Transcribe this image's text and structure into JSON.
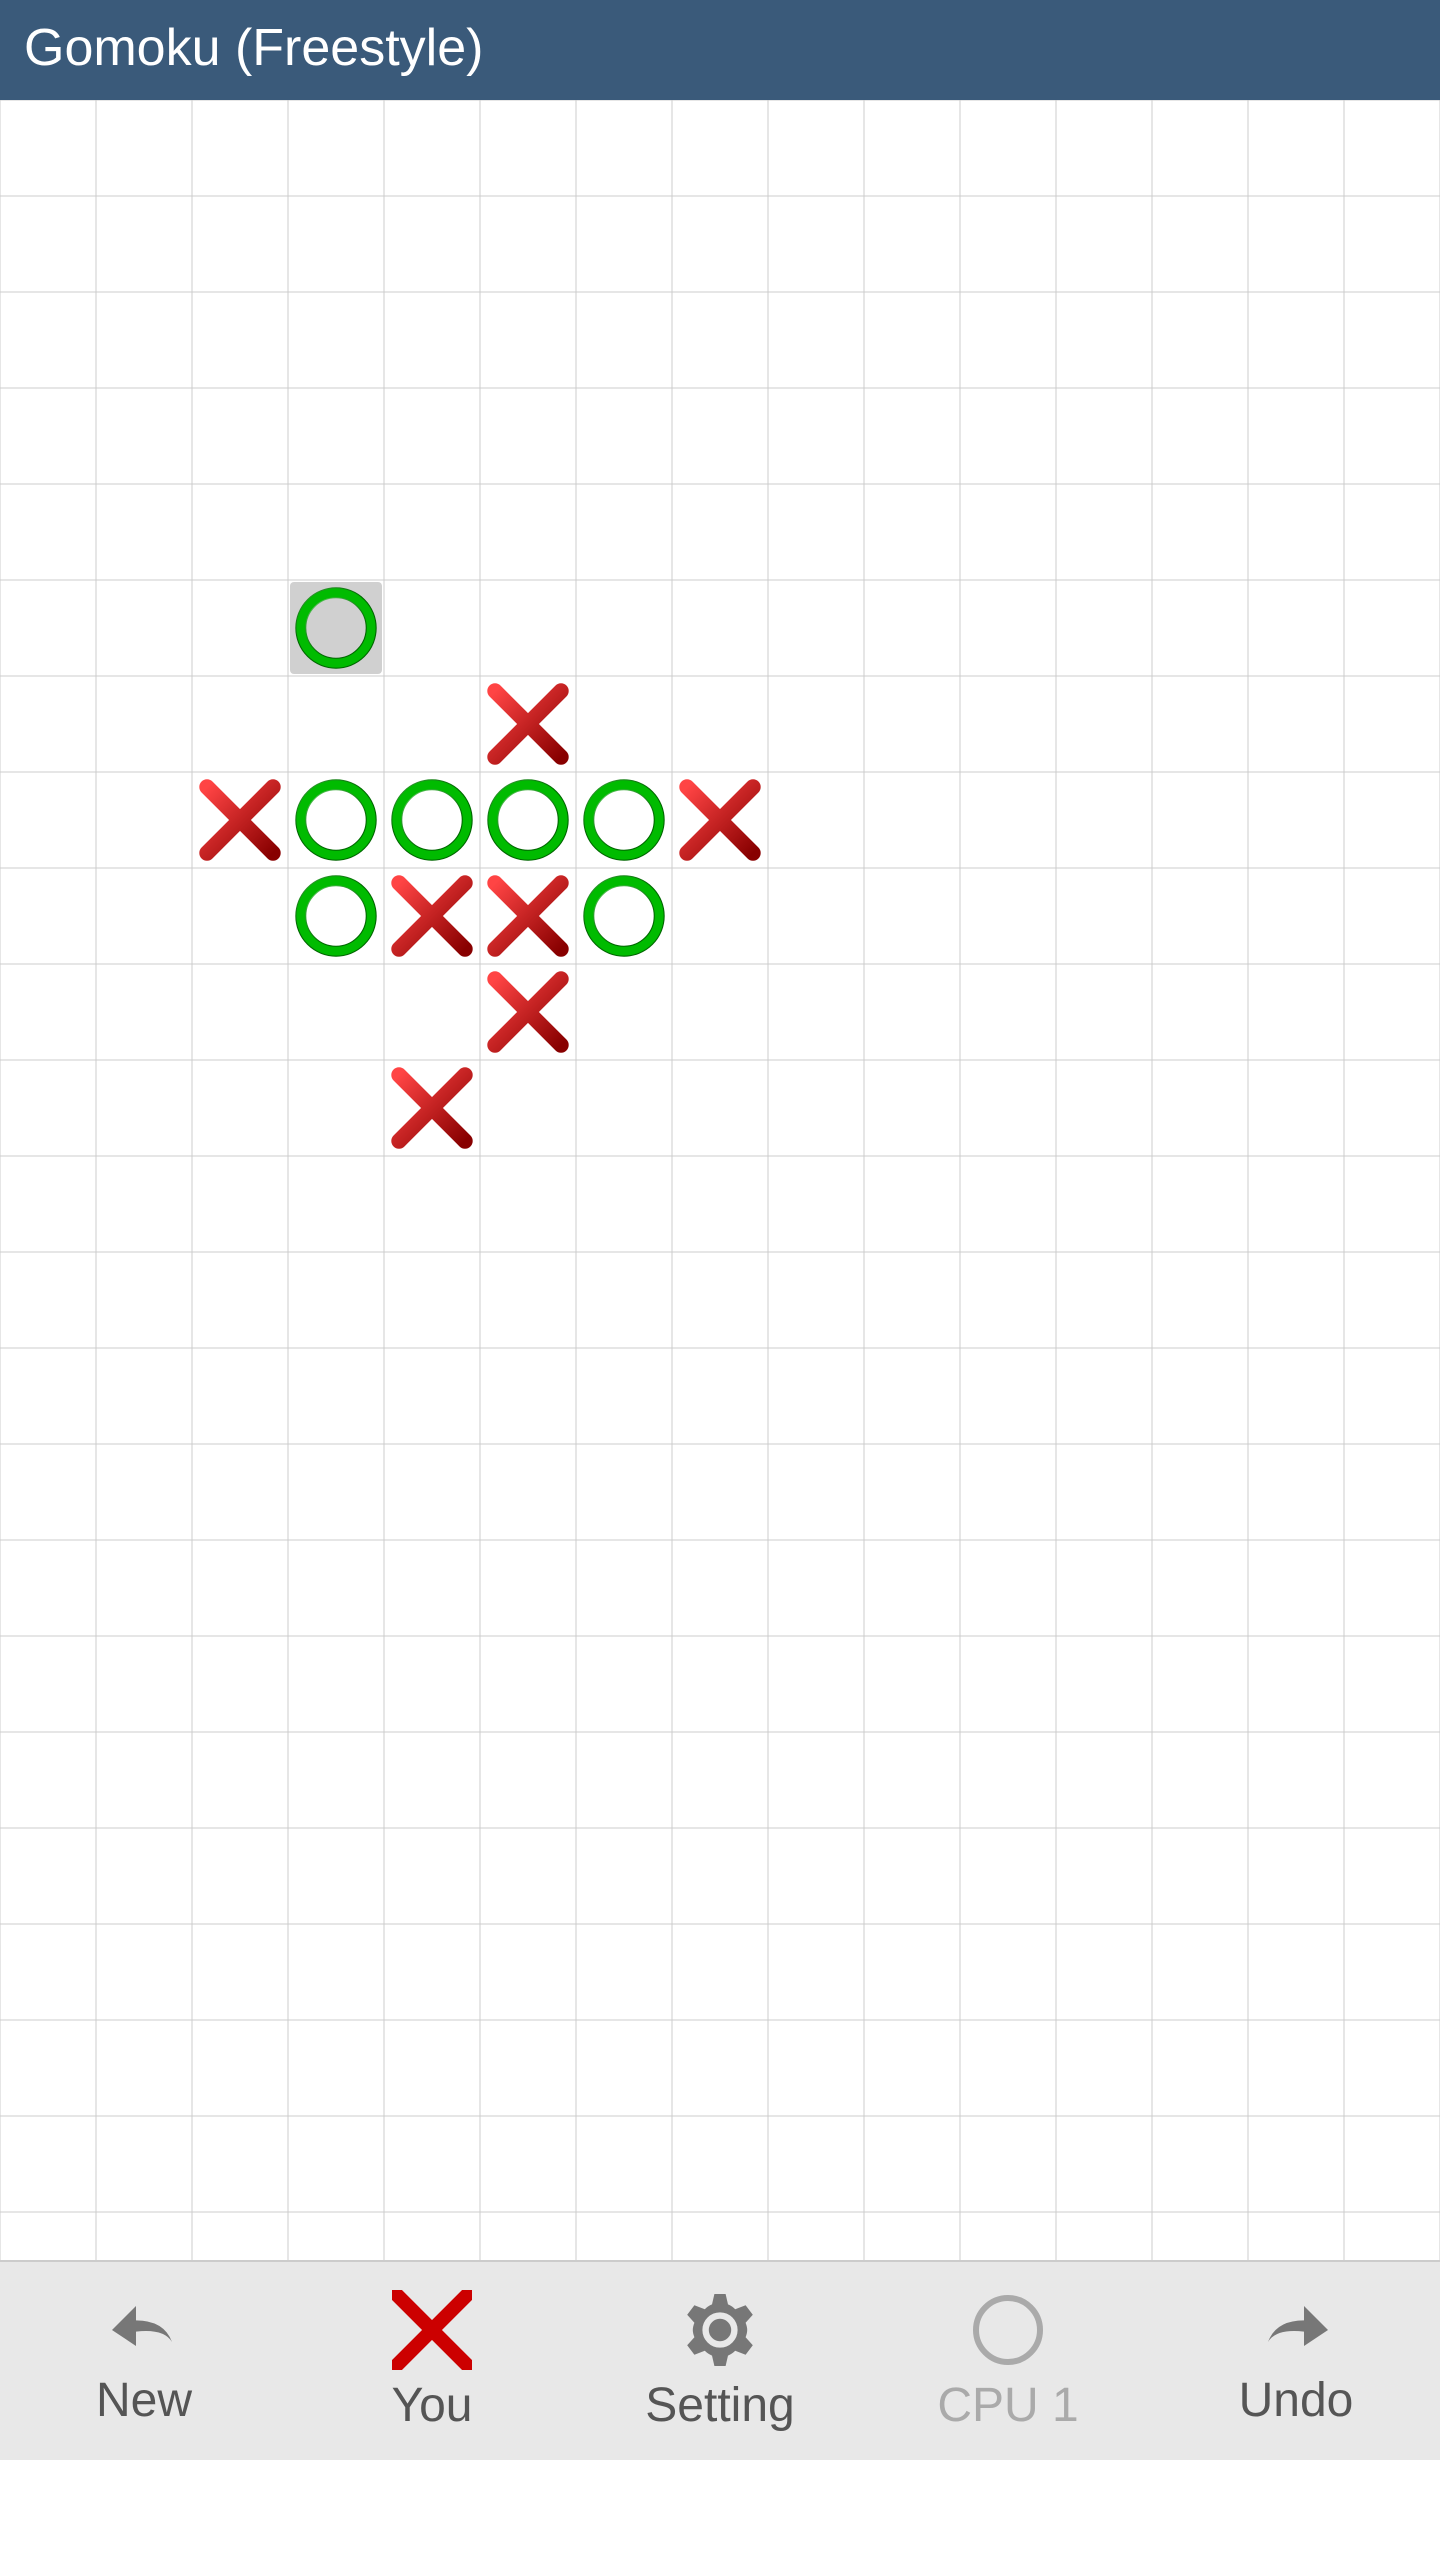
{
  "title": "Gomoku (Freestyle)",
  "board": {
    "cols": 15,
    "rows": 20,
    "cellSize": 96,
    "offsetX": 0,
    "offsetY": 0
  },
  "pieces": [
    {
      "type": "O",
      "col": 3,
      "row": 5,
      "highlight": true
    },
    {
      "type": "X",
      "col": 5,
      "row": 6,
      "highlight": false
    },
    {
      "type": "X",
      "col": 2,
      "row": 7,
      "highlight": false
    },
    {
      "type": "O",
      "col": 3,
      "row": 7,
      "highlight": false
    },
    {
      "type": "O",
      "col": 4,
      "row": 7,
      "highlight": false
    },
    {
      "type": "O",
      "col": 5,
      "row": 7,
      "highlight": false
    },
    {
      "type": "O",
      "col": 6,
      "row": 7,
      "highlight": false
    },
    {
      "type": "X",
      "col": 7,
      "row": 7,
      "highlight": false
    },
    {
      "type": "O",
      "col": 3,
      "row": 8,
      "highlight": false
    },
    {
      "type": "X",
      "col": 4,
      "row": 8,
      "highlight": false
    },
    {
      "type": "X",
      "col": 5,
      "row": 8,
      "highlight": false
    },
    {
      "type": "O",
      "col": 6,
      "row": 8,
      "highlight": false
    },
    {
      "type": "X",
      "col": 5,
      "row": 9,
      "highlight": false
    },
    {
      "type": "X",
      "col": 4,
      "row": 10,
      "highlight": false
    }
  ],
  "bottomBar": {
    "newLabel": "New",
    "youLabel": "You",
    "settingLabel": "Setting",
    "cpuLabel": "CPU 1",
    "undoLabel": "Undo"
  }
}
